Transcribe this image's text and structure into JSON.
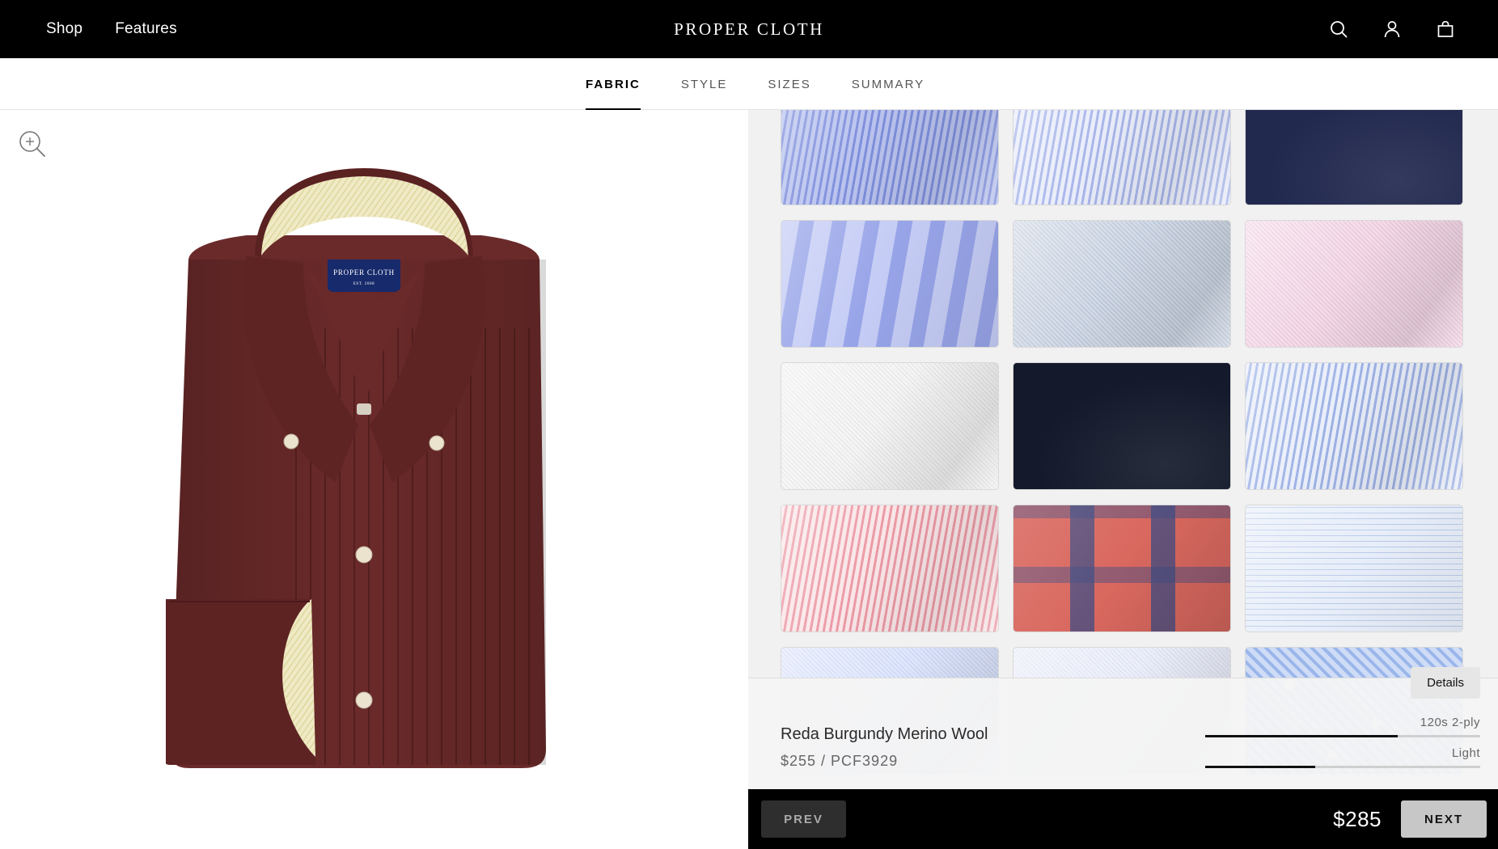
{
  "header": {
    "nav": [
      {
        "label": "Shop",
        "name": "nav-shop"
      },
      {
        "label": "Features",
        "name": "nav-features"
      }
    ],
    "logo": "PROPER CLOTH",
    "icons": [
      "search-icon",
      "account-icon",
      "bag-icon"
    ]
  },
  "steps": {
    "tabs": [
      {
        "label": "FABRIC",
        "active": true
      },
      {
        "label": "STYLE",
        "active": false
      },
      {
        "label": "SIZES",
        "active": false
      },
      {
        "label": "SUMMARY",
        "active": false
      }
    ]
  },
  "preview": {
    "zoom_icon": "zoom-in-icon",
    "shirt_label": "PROPER CLOTH",
    "shirt_label_sub": "EST. 2008",
    "shirt_color": "#6b2a2a"
  },
  "swatches": [
    {
      "name": "blue-stripe",
      "base": "#b9c3ee",
      "stripe": "#7f8fdc",
      "pattern": "stripe"
    },
    {
      "name": "light-blue-stripe",
      "base": "#e9edfa",
      "stripe": "#a9b6ea",
      "pattern": "stripe"
    },
    {
      "name": "navy-solid",
      "base": "#22294f",
      "stripe": "#1a2042",
      "pattern": "solid"
    },
    {
      "name": "blue-dobby-stripe",
      "base": "#c5ccf5",
      "stripe": "#97a4e8",
      "pattern": "wide-stripe"
    },
    {
      "name": "grey-blue-texture",
      "base": "#d2dae6",
      "stripe": "#b2bfd2",
      "pattern": "texture"
    },
    {
      "name": "pink-texture",
      "base": "#f4dbe9",
      "stripe": "#e7bfd3",
      "pattern": "texture"
    },
    {
      "name": "white-texture",
      "base": "#f4f4f4",
      "stripe": "#e3e3e3",
      "pattern": "texture"
    },
    {
      "name": "midnight-solid",
      "base": "#141a2b",
      "stripe": "#0f1422",
      "pattern": "solid"
    },
    {
      "name": "blue-bengal-stripe",
      "base": "#e9eef9",
      "stripe": "#9eb2e6",
      "pattern": "stripe"
    },
    {
      "name": "pink-stripe",
      "base": "#f9e6e8",
      "stripe": "#ec9aa6",
      "pattern": "stripe"
    },
    {
      "name": "red-navy-plaid",
      "base": "#d9685f",
      "stripe": "#3f4c84",
      "pattern": "plaid"
    },
    {
      "name": "blue-check",
      "base": "#e7eef9",
      "stripe": "#b9cae9",
      "pattern": "check"
    },
    {
      "name": "blue-light",
      "base": "#dfe6fb",
      "stripe": "#c6d2f5",
      "pattern": "texture"
    },
    {
      "name": "lavender-light",
      "base": "#eceef9",
      "stripe": "#dadef2",
      "pattern": "texture"
    },
    {
      "name": "blue-floral",
      "base": "#cfdcf6",
      "stripe": "#9ab6ea",
      "pattern": "floral"
    }
  ],
  "fabric": {
    "name": "Reda Burgundy Merino Wool",
    "price_code": "$255  /  PCF3929",
    "details_label": "Details",
    "attributes": [
      {
        "label": "120s 2-ply",
        "level": 0.7
      },
      {
        "label": "Light",
        "level": 0.4
      }
    ]
  },
  "footer": {
    "prev_label": "PREV",
    "total": "$285",
    "next_label": "NEXT"
  }
}
